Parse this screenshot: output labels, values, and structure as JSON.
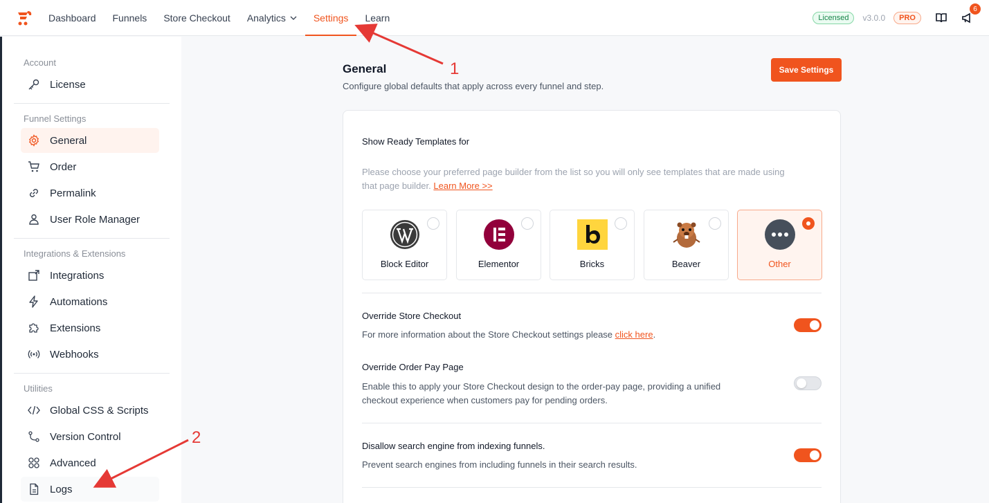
{
  "nav": {
    "items": [
      {
        "label": "Dashboard"
      },
      {
        "label": "Funnels"
      },
      {
        "label": "Store Checkout"
      },
      {
        "label": "Analytics"
      },
      {
        "label": "Settings"
      },
      {
        "label": "Learn"
      }
    ],
    "active": "Settings",
    "licensed_badge": "Licensed",
    "version": "v3.0.0",
    "pro_badge": "PRO",
    "notification_count": "6"
  },
  "sidebar": {
    "sections": [
      {
        "title": "Account",
        "items": [
          {
            "label": "License",
            "icon": "key-icon"
          }
        ]
      },
      {
        "title": "Funnel Settings",
        "items": [
          {
            "label": "General",
            "icon": "gear-icon"
          },
          {
            "label": "Order",
            "icon": "cart-icon"
          },
          {
            "label": "Permalink",
            "icon": "link-icon"
          },
          {
            "label": "User Role Manager",
            "icon": "user-icon"
          }
        ]
      },
      {
        "title": "Integrations & Extensions",
        "items": [
          {
            "label": "Integrations",
            "icon": "integrations-icon"
          },
          {
            "label": "Automations",
            "icon": "lightning-icon"
          },
          {
            "label": "Extensions",
            "icon": "puzzle-icon"
          },
          {
            "label": "Webhooks",
            "icon": "broadcast-icon"
          }
        ]
      },
      {
        "title": "Utilities",
        "items": [
          {
            "label": "Global CSS & Scripts",
            "icon": "code-icon"
          },
          {
            "label": "Version Control",
            "icon": "branch-icon"
          },
          {
            "label": "Advanced",
            "icon": "grid-icon"
          },
          {
            "label": "Logs",
            "icon": "document-icon"
          }
        ]
      }
    ],
    "active": "General"
  },
  "main": {
    "title": "General",
    "subtitle": "Configure global defaults that apply across every funnel and step.",
    "save_label": "Save Settings",
    "templates": {
      "label": "Show Ready Templates for",
      "desc_line1": "Please choose your preferred page builder from the list so you will only see templates that are made using",
      "desc_line2": "that page builder.",
      "learn_more": "Learn More >>",
      "builders": [
        {
          "name": "Block Editor",
          "icon": "wordpress-icon"
        },
        {
          "name": "Elementor",
          "icon": "elementor-icon"
        },
        {
          "name": "Bricks",
          "icon": "bricks-icon"
        },
        {
          "name": "Beaver",
          "icon": "beaver-icon"
        },
        {
          "name": "Other",
          "icon": "more-icon"
        }
      ],
      "selected": "Other"
    },
    "override_checkout": {
      "label": "Override Store Checkout",
      "desc": "For more information about the Store Checkout settings please",
      "link": "click here",
      "after": ".",
      "enabled": true
    },
    "override_order_pay": {
      "label": "Override Order Pay Page",
      "desc_line1": "Enable this to apply your Store Checkout design to the order-pay page, providing a unified",
      "desc_line2": "checkout experience when customers pay for pending orders.",
      "enabled": false
    },
    "disallow_indexing": {
      "label": "Disallow search engine from indexing funnels.",
      "desc": "Prevent search engines from including funnels in their search results.",
      "enabled": true
    }
  },
  "annotations": {
    "first": "1",
    "second": "2"
  },
  "colors": {
    "accent": "#f0541e",
    "arrow": "#e53935"
  }
}
